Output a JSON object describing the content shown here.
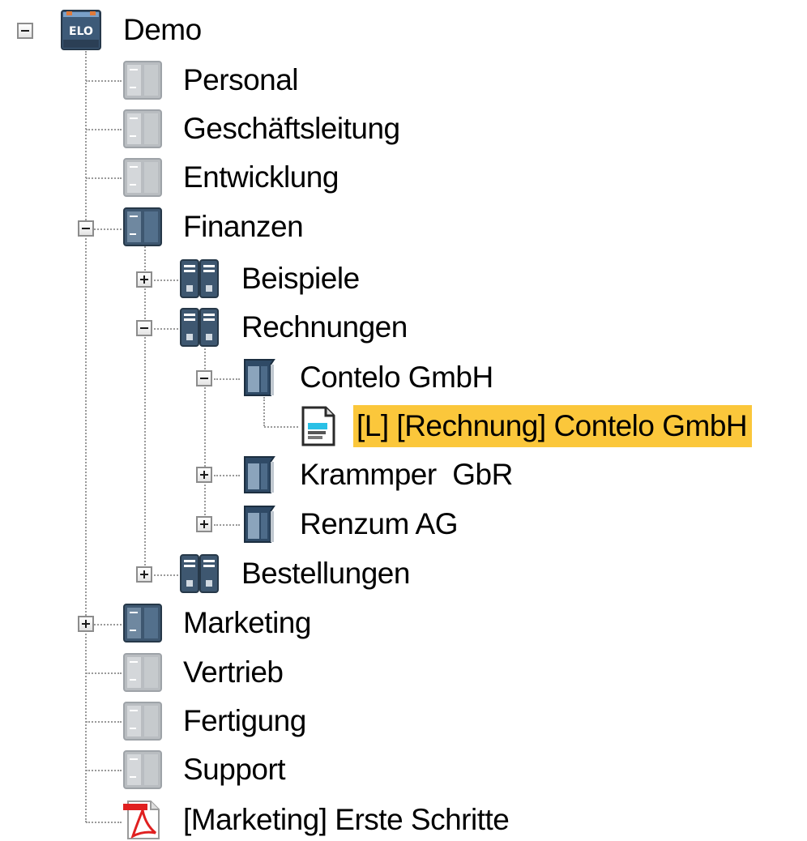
{
  "tree": {
    "root": {
      "label": "Demo",
      "icon": "elo-archive-icon",
      "expanded": true,
      "children": [
        {
          "label": "Personal",
          "icon": "cabinet-icon",
          "state": "disabled"
        },
        {
          "label": "Geschäftsleitung",
          "icon": "cabinet-icon",
          "state": "disabled"
        },
        {
          "label": "Entwicklung",
          "icon": "cabinet-icon",
          "state": "disabled"
        },
        {
          "label": "Finanzen",
          "icon": "cabinet-icon",
          "expanded": true,
          "children": [
            {
              "label": "Beispiele",
              "icon": "double-cabinet-icon",
              "expanded": false
            },
            {
              "label": "Rechnungen",
              "icon": "double-cabinet-icon",
              "expanded": true,
              "children": [
                {
                  "label": "Contelo GmbH",
                  "icon": "folder-icon",
                  "expanded": true,
                  "children": [
                    {
                      "label": "[L] [Rechnung] Contelo GmbH",
                      "icon": "document-icon",
                      "selected": true
                    }
                  ]
                },
                {
                  "label": "Krammper  GbR",
                  "icon": "folder-icon",
                  "expanded": false
                },
                {
                  "label": "Renzum AG",
                  "icon": "folder-icon",
                  "expanded": false
                }
              ]
            },
            {
              "label": "Bestellungen",
              "icon": "double-cabinet-icon",
              "expanded": false
            }
          ]
        },
        {
          "label": "Marketing",
          "icon": "cabinet-icon",
          "expanded": false
        },
        {
          "label": "Vertrieb",
          "icon": "cabinet-icon",
          "state": "disabled"
        },
        {
          "label": "Fertigung",
          "icon": "cabinet-icon",
          "state": "disabled"
        },
        {
          "label": "Support",
          "icon": "cabinet-icon",
          "state": "disabled"
        },
        {
          "label": "[Marketing] Erste Schritte",
          "icon": "pdf-icon"
        }
      ]
    }
  },
  "colors": {
    "selection": "#fbc73b",
    "connector": "#9a9a9a",
    "cabinet": "#3e5770",
    "cabinet_disabled": "#b8bcc0",
    "pdf": "#e02020"
  }
}
